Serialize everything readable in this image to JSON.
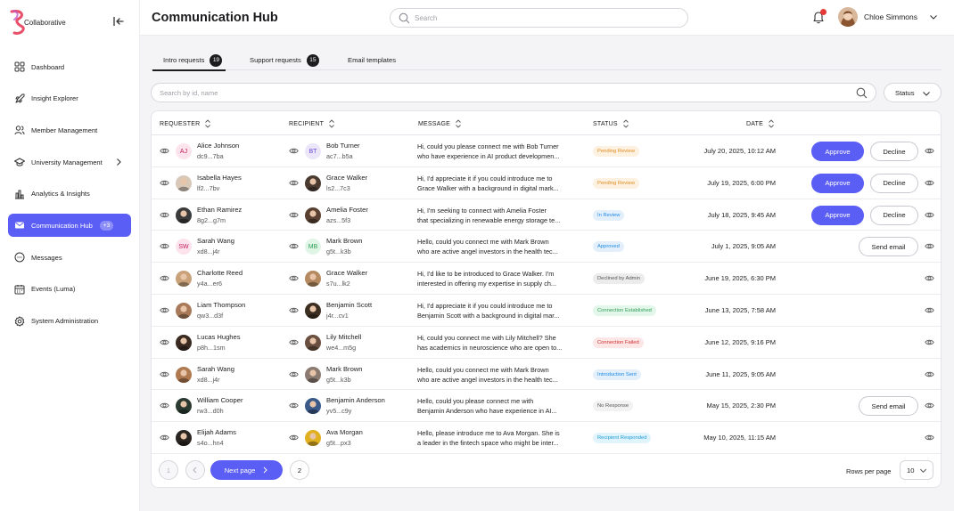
{
  "brand": {
    "name": "Collaborative",
    "accent": "#5b5ef4"
  },
  "sidebar": {
    "items": [
      {
        "label": "Dashboard",
        "icon": "grid-icon"
      },
      {
        "label": "Insight Explorer",
        "icon": "rocket-icon"
      },
      {
        "label": "Member Management",
        "icon": "users-icon"
      },
      {
        "label": "University Management",
        "icon": "graduation-cap-icon",
        "has_submenu": true
      },
      {
        "label": "Analytics & Insights",
        "icon": "bar-chart-icon"
      },
      {
        "label": "Communication Hub",
        "icon": "mail-icon",
        "active": true,
        "badge": "+3"
      },
      {
        "label": "Messages",
        "icon": "chat-bubble-icon"
      },
      {
        "label": "Events (Luma)",
        "icon": "calendar-icon"
      },
      {
        "label": "System Administration",
        "icon": "settings-icon"
      }
    ]
  },
  "header": {
    "title": "Communication Hub",
    "search_placeholder": "Search",
    "user_name": "Chloe Simmons"
  },
  "tabs": [
    {
      "label": "Intro requests",
      "count": "19",
      "active": true
    },
    {
      "label": "Support requests",
      "count": "15"
    },
    {
      "label": "Email templates"
    }
  ],
  "filter": {
    "search_placeholder": "Search by id, name",
    "status_label": "Status"
  },
  "table": {
    "columns": {
      "requester": "REQUESTER",
      "recipient": "RECIPIENT",
      "message": "MESSAGE",
      "status": "STATUS",
      "date": "DATE"
    },
    "rows": [
      {
        "requester": {
          "name": "Alice Johnson",
          "id": "dc9...7ba",
          "initials": "AJ",
          "avatar_bg": "#fde4ec",
          "avatar_fg": "#c2185b"
        },
        "recipient": {
          "name": "Bob Turner",
          "id": "ac7...b5a",
          "initials": "BT",
          "avatar_bg": "#ece6fb",
          "avatar_fg": "#6a4bd6"
        },
        "message": [
          "Hi, could you please connect me with Bob Turner",
          "who have experience in AI product developmen..."
        ],
        "status": "Pending Review",
        "status_color": "#e08a1e",
        "status_bg": "#fdf1e1",
        "date": "July 20, 2025, 10:12 AM",
        "actions": [
          "Approve",
          "Decline"
        ]
      },
      {
        "requester": {
          "name": "Isabella Hayes",
          "id": "lf2...7bv",
          "avatar_bg": "#d8c8b8"
        },
        "recipient": {
          "name": "Grace Walker",
          "id": "ls2...7c3",
          "avatar_bg": "#4a3a30"
        },
        "message": [
          "Hi, I'd appreciate it if you could introduce me to",
          "Grace Walker with a background in digital mark..."
        ],
        "status": "Pending Review",
        "status_color": "#e08a1e",
        "status_bg": "#fdf1e1",
        "date": "July 19, 2025, 6:00 PM",
        "actions": [
          "Approve",
          "Decline"
        ]
      },
      {
        "requester": {
          "name": "Ethan Ramirez",
          "id": "8g2...g7m",
          "avatar_bg": "#3a3a3a"
        },
        "recipient": {
          "name": "Amelia Foster",
          "id": "azs...5f3",
          "avatar_bg": "#5a4030"
        },
        "message": [
          "Hi, I'm seeking to connect with Amelia Foster",
          "that specializing in renewable energy storage te..."
        ],
        "status": "In Review",
        "status_color": "#1e88e5",
        "status_bg": "#e3f0fc",
        "date": "July 18, 2025, 9:45 AM",
        "actions": [
          "Approve",
          "Decline"
        ]
      },
      {
        "requester": {
          "name": "Sarah Wang",
          "id": "xd8...j4r",
          "initials": "SW",
          "avatar_bg": "#fde4ec",
          "avatar_fg": "#c2185b"
        },
        "recipient": {
          "name": "Mark Brown",
          "id": "g5t...k3b",
          "initials": "MB",
          "avatar_bg": "#e0f5e6",
          "avatar_fg": "#2e9e55"
        },
        "message": [
          "Hello, could you connect me with Mark Brown",
          "who are active angel investors in the health tec..."
        ],
        "status": "Approved",
        "status_color": "#1e88e5",
        "status_bg": "#e3f0fc",
        "date": "July 1, 2025, 9:05 AM",
        "actions": [
          "Send email"
        ]
      },
      {
        "requester": {
          "name": "Charlotte Reed",
          "id": "y4a...er6",
          "avatar_bg": "#c9a27a"
        },
        "recipient": {
          "name": "Grace Walker",
          "id": "s7u...lk2",
          "avatar_bg": "#b58a60"
        },
        "message": [
          "Hi, I'd like to be introduced to Grace Walker. I'm",
          "interested in offering my expertise in supply ch..."
        ],
        "status": "Declined by Admin",
        "status_color": "#555555",
        "status_bg": "#ececec",
        "date": "June 19, 2025, 6:30 PM",
        "actions": []
      },
      {
        "requester": {
          "name": "Liam Thompson",
          "id": "qw3...d3f",
          "avatar_bg": "#a87a5a"
        },
        "recipient": {
          "name": "Benjamin Scott",
          "id": "j4r...cv1",
          "avatar_bg": "#3d2e22"
        },
        "message": [
          "Hi, I'd appreciate it if you could introduce me to",
          "Benjamin Scott with a background in digital mar..."
        ],
        "status": "Connection Established",
        "status_color": "#2e9e55",
        "status_bg": "#e3f6ea",
        "date": "June 13, 2025, 7:58 AM",
        "actions": []
      },
      {
        "requester": {
          "name": "Lucas Hughes",
          "id": "p8h...1sm",
          "avatar_bg": "#3a2a22"
        },
        "recipient": {
          "name": "Lily Mitchell",
          "id": "we4...m5g",
          "avatar_bg": "#6a5040"
        },
        "message": [
          "Hi, could you connect me with Lily Mitchell? She",
          "has academics in neuroscience who are open to..."
        ],
        "status": "Connection Failed",
        "status_color": "#d32f2f",
        "status_bg": "#fde6e6",
        "date": "June 12, 2025, 9:16 PM",
        "actions": []
      },
      {
        "requester": {
          "name": "Sarah Wang",
          "id": "xd8...j4r",
          "avatar_bg": "#b07a50"
        },
        "recipient": {
          "name": "Mark Brown",
          "id": "g5t...k3b",
          "avatar_bg": "#8a7a70"
        },
        "message": [
          "Hello, could you connect me with Mark Brown",
          "who are active angel investors in the health tec..."
        ],
        "status": "Introduction Sent",
        "status_color": "#1e88e5",
        "status_bg": "#e3f0fc",
        "date": "June 11, 2025, 9:05 AM",
        "actions": []
      },
      {
        "requester": {
          "name": "William Cooper",
          "id": "rw3...d0h",
          "avatar_bg": "#2a3a30"
        },
        "recipient": {
          "name": "Benjamin Anderson",
          "id": "yv5...c9y",
          "avatar_bg": "#3a5a8a"
        },
        "message": [
          "Hello, could you please connect me with",
          "Benjamin Anderson who have experience in AI..."
        ],
        "status": "No Response",
        "status_color": "#555555",
        "status_bg": "#f2f2f2",
        "date": "May 15, 2025, 2:30 PM",
        "actions": [
          "Send email"
        ]
      },
      {
        "requester": {
          "name": "Elijah Adams",
          "id": "s4o...hn4",
          "avatar_bg": "#2a2420"
        },
        "recipient": {
          "name": "Ava Morgan",
          "id": "g5t...px3",
          "avatar_bg": "#e0b020"
        },
        "message": [
          "Hello, please introduce me to Ava Morgan. She is",
          "a leader in the fintech space who might be inter..."
        ],
        "status": "Recipient Responded",
        "status_color": "#1e9ad6",
        "status_bg": "#e1f4fb",
        "date": "May 10, 2025, 11:15 AM",
        "actions": []
      }
    ]
  },
  "pagination": {
    "pages": [
      "1",
      "2"
    ],
    "next_label": "Next page",
    "rows_per_page_label": "Rows per page",
    "rows_per_page": "10"
  }
}
